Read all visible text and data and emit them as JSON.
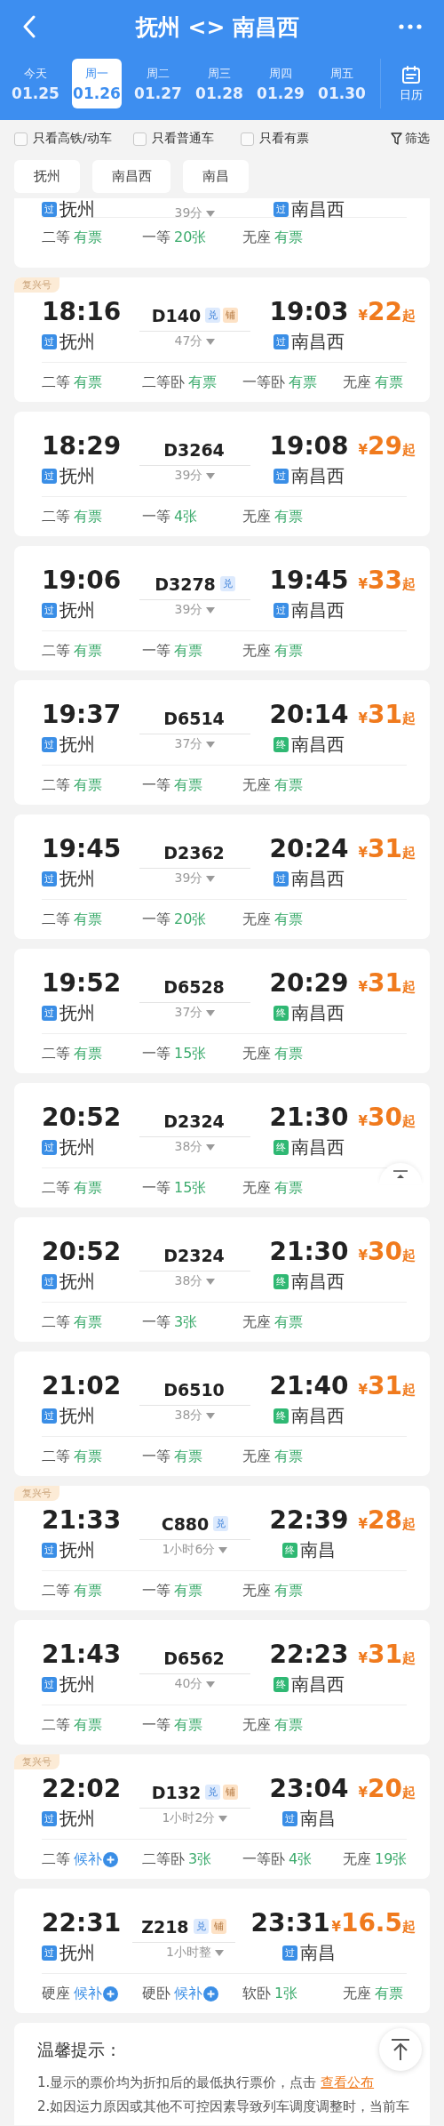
{
  "header": {
    "title": "抚州 <> 南昌西"
  },
  "dates": [
    {
      "day": "今天",
      "date": "01.25",
      "selected": false
    },
    {
      "day": "周一",
      "date": "01.26",
      "selected": true
    },
    {
      "day": "周二",
      "date": "01.27",
      "selected": false
    },
    {
      "day": "周三",
      "date": "01.28",
      "selected": false
    },
    {
      "day": "周四",
      "date": "01.29",
      "selected": false
    },
    {
      "day": "周五",
      "date": "01.30",
      "selected": false
    }
  ],
  "calendar_label": "日历",
  "filters": [
    {
      "label": "只看高铁/动车",
      "checked": false
    },
    {
      "label": "只看普通车",
      "checked": false
    },
    {
      "label": "只看有票",
      "checked": false
    }
  ],
  "filter_button": "筛选",
  "stations": [
    "抚州",
    "南昌西",
    "南昌"
  ],
  "trains": [
    {
      "kind": "partial",
      "dep": {
        "stop": {
          "label": "过",
          "kind": "pass"
        },
        "name": "抚州"
      },
      "duration": "39分",
      "arr": {
        "stop": {
          "label": "过",
          "kind": "pass"
        },
        "name": "南昌西"
      },
      "seats": [
        {
          "class": "二等",
          "status": "有票",
          "kind": "available"
        },
        {
          "class": "一等",
          "status": "20张",
          "kind": "available"
        },
        {
          "class": "无座",
          "status": "有票",
          "kind": "available"
        }
      ]
    },
    {
      "kind": "full",
      "tag": "复兴号",
      "dep_time": "18:16",
      "number": "D140",
      "badges": [
        {
          "label": "兑",
          "kind": "exchange"
        },
        {
          "label": "铺",
          "kind": "berth"
        }
      ],
      "arr_time": "19:03",
      "price": {
        "currency": "¥",
        "amount": "22",
        "suffix": "起"
      },
      "dep": {
        "stop": {
          "label": "过",
          "kind": "pass"
        },
        "name": "抚州"
      },
      "duration": "47分",
      "arr": {
        "stop": {
          "label": "过",
          "kind": "pass"
        },
        "name": "南昌西"
      },
      "seats": [
        {
          "class": "二等",
          "status": "有票",
          "kind": "available"
        },
        {
          "class": "二等卧",
          "status": "有票",
          "kind": "available"
        },
        {
          "class": "一等卧",
          "status": "有票",
          "kind": "available"
        },
        {
          "class": "无座",
          "status": "有票",
          "kind": "available"
        }
      ]
    },
    {
      "kind": "full",
      "dep_time": "18:29",
      "number": "D3264",
      "arr_time": "19:08",
      "price": {
        "currency": "¥",
        "amount": "29",
        "suffix": "起"
      },
      "dep": {
        "stop": {
          "label": "过",
          "kind": "pass"
        },
        "name": "抚州"
      },
      "duration": "39分",
      "arr": {
        "stop": {
          "label": "过",
          "kind": "pass"
        },
        "name": "南昌西"
      },
      "seats": [
        {
          "class": "二等",
          "status": "有票",
          "kind": "available"
        },
        {
          "class": "一等",
          "status": "4张",
          "kind": "available"
        },
        {
          "class": "无座",
          "status": "有票",
          "kind": "available"
        }
      ]
    },
    {
      "kind": "full",
      "dep_time": "19:06",
      "number": "D3278",
      "badges": [
        {
          "label": "兑",
          "kind": "exchange"
        }
      ],
      "arr_time": "19:45",
      "price": {
        "currency": "¥",
        "amount": "33",
        "suffix": "起"
      },
      "dep": {
        "stop": {
          "label": "过",
          "kind": "pass"
        },
        "name": "抚州"
      },
      "duration": "39分",
      "arr": {
        "stop": {
          "label": "过",
          "kind": "pass"
        },
        "name": "南昌西"
      },
      "seats": [
        {
          "class": "二等",
          "status": "有票",
          "kind": "available"
        },
        {
          "class": "一等",
          "status": "有票",
          "kind": "available"
        },
        {
          "class": "无座",
          "status": "有票",
          "kind": "available"
        }
      ]
    },
    {
      "kind": "full",
      "dep_time": "19:37",
      "number": "D6514",
      "arr_time": "20:14",
      "price": {
        "currency": "¥",
        "amount": "31",
        "suffix": "起"
      },
      "dep": {
        "stop": {
          "label": "过",
          "kind": "pass"
        },
        "name": "抚州"
      },
      "duration": "37分",
      "arr": {
        "stop": {
          "label": "终",
          "kind": "terminal"
        },
        "name": "南昌西"
      },
      "seats": [
        {
          "class": "二等",
          "status": "有票",
          "kind": "available"
        },
        {
          "class": "一等",
          "status": "有票",
          "kind": "available"
        },
        {
          "class": "无座",
          "status": "有票",
          "kind": "available"
        }
      ]
    },
    {
      "kind": "full",
      "dep_time": "19:45",
      "number": "D2362",
      "arr_time": "20:24",
      "price": {
        "currency": "¥",
        "amount": "31",
        "suffix": "起"
      },
      "dep": {
        "stop": {
          "label": "过",
          "kind": "pass"
        },
        "name": "抚州"
      },
      "duration": "39分",
      "arr": {
        "stop": {
          "label": "过",
          "kind": "pass"
        },
        "name": "南昌西"
      },
      "seats": [
        {
          "class": "二等",
          "status": "有票",
          "kind": "available"
        },
        {
          "class": "一等",
          "status": "20张",
          "kind": "available"
        },
        {
          "class": "无座",
          "status": "有票",
          "kind": "available"
        }
      ]
    },
    {
      "kind": "full",
      "dep_time": "19:52",
      "number": "D6528",
      "arr_time": "20:29",
      "price": {
        "currency": "¥",
        "amount": "31",
        "suffix": "起"
      },
      "dep": {
        "stop": {
          "label": "过",
          "kind": "pass"
        },
        "name": "抚州"
      },
      "duration": "37分",
      "arr": {
        "stop": {
          "label": "终",
          "kind": "terminal"
        },
        "name": "南昌西"
      },
      "seats": [
        {
          "class": "二等",
          "status": "有票",
          "kind": "available"
        },
        {
          "class": "一等",
          "status": "15张",
          "kind": "available"
        },
        {
          "class": "无座",
          "status": "有票",
          "kind": "available"
        }
      ]
    },
    {
      "kind": "full",
      "dep_time": "20:52",
      "number": "D2324",
      "arr_time": "21:30",
      "price": {
        "currency": "¥",
        "amount": "30",
        "suffix": "起"
      },
      "dep": {
        "stop": {
          "label": "过",
          "kind": "pass"
        },
        "name": "抚州"
      },
      "duration": "38分",
      "arr": {
        "stop": {
          "label": "终",
          "kind": "terminal"
        },
        "name": "南昌西"
      },
      "seats": [
        {
          "class": "二等",
          "status": "有票",
          "kind": "available"
        },
        {
          "class": "一等",
          "status": "15张",
          "kind": "available"
        },
        {
          "class": "无座",
          "status": "有票",
          "kind": "available"
        }
      ]
    },
    {
      "kind": "full",
      "dep_time": "20:52",
      "number": "D2324",
      "arr_time": "21:30",
      "price": {
        "currency": "¥",
        "amount": "30",
        "suffix": "起"
      },
      "dep": {
        "stop": {
          "label": "过",
          "kind": "pass"
        },
        "name": "抚州"
      },
      "duration": "38分",
      "arr": {
        "stop": {
          "label": "终",
          "kind": "terminal"
        },
        "name": "南昌西"
      },
      "seats": [
        {
          "class": "二等",
          "status": "有票",
          "kind": "available"
        },
        {
          "class": "一等",
          "status": "3张",
          "kind": "available"
        },
        {
          "class": "无座",
          "status": "有票",
          "kind": "available"
        }
      ]
    },
    {
      "kind": "full",
      "dep_time": "21:02",
      "number": "D6510",
      "arr_time": "21:40",
      "price": {
        "currency": "¥",
        "amount": "31",
        "suffix": "起"
      },
      "dep": {
        "stop": {
          "label": "过",
          "kind": "pass"
        },
        "name": "抚州"
      },
      "duration": "38分",
      "arr": {
        "stop": {
          "label": "终",
          "kind": "terminal"
        },
        "name": "南昌西"
      },
      "seats": [
        {
          "class": "二等",
          "status": "有票",
          "kind": "available"
        },
        {
          "class": "一等",
          "status": "有票",
          "kind": "available"
        },
        {
          "class": "无座",
          "status": "有票",
          "kind": "available"
        }
      ]
    },
    {
      "kind": "full",
      "tag": "复兴号",
      "dep_time": "21:33",
      "number": "C880",
      "badges": [
        {
          "label": "兑",
          "kind": "exchange"
        }
      ],
      "arr_time": "22:39",
      "price": {
        "currency": "¥",
        "amount": "28",
        "suffix": "起"
      },
      "dep": {
        "stop": {
          "label": "过",
          "kind": "pass"
        },
        "name": "抚州"
      },
      "duration": "1小时6分",
      "arr": {
        "stop": {
          "label": "终",
          "kind": "terminal"
        },
        "name": "南昌"
      },
      "seats": [
        {
          "class": "二等",
          "status": "有票",
          "kind": "available"
        },
        {
          "class": "一等",
          "status": "有票",
          "kind": "available"
        },
        {
          "class": "无座",
          "status": "有票",
          "kind": "available"
        }
      ]
    },
    {
      "kind": "full",
      "dep_time": "21:43",
      "number": "D6562",
      "arr_time": "22:23",
      "price": {
        "currency": "¥",
        "amount": "31",
        "suffix": "起"
      },
      "dep": {
        "stop": {
          "label": "过",
          "kind": "pass"
        },
        "name": "抚州"
      },
      "duration": "40分",
      "arr": {
        "stop": {
          "label": "终",
          "kind": "terminal"
        },
        "name": "南昌西"
      },
      "seats": [
        {
          "class": "二等",
          "status": "有票",
          "kind": "available"
        },
        {
          "class": "一等",
          "status": "有票",
          "kind": "available"
        },
        {
          "class": "无座",
          "status": "有票",
          "kind": "available"
        }
      ]
    },
    {
      "kind": "full",
      "tag": "复兴号",
      "dep_time": "22:02",
      "number": "D132",
      "badges": [
        {
          "label": "兑",
          "kind": "exchange"
        },
        {
          "label": "铺",
          "kind": "berth"
        }
      ],
      "arr_time": "23:04",
      "price": {
        "currency": "¥",
        "amount": "20",
        "suffix": "起"
      },
      "dep": {
        "stop": {
          "label": "过",
          "kind": "pass"
        },
        "name": "抚州"
      },
      "duration": "1小时2分",
      "arr": {
        "stop": {
          "label": "过",
          "kind": "pass"
        },
        "name": "南昌"
      },
      "seats": [
        {
          "class": "二等",
          "status": "候补",
          "kind": "waitlist"
        },
        {
          "class": "二等卧",
          "status": "3张",
          "kind": "available"
        },
        {
          "class": "一等卧",
          "status": "4张",
          "kind": "available"
        },
        {
          "class": "无座",
          "status": "19张",
          "kind": "available"
        }
      ]
    },
    {
      "kind": "full",
      "dep_time": "22:31",
      "number": "Z218",
      "badges": [
        {
          "label": "兑",
          "kind": "exchange"
        },
        {
          "label": "铺",
          "kind": "berth"
        }
      ],
      "arr_time": "23:31",
      "price": {
        "currency": "¥",
        "amount": "16.5",
        "suffix": "起"
      },
      "dep": {
        "stop": {
          "label": "过",
          "kind": "pass"
        },
        "name": "抚州"
      },
      "duration": "1小时整",
      "arr": {
        "stop": {
          "label": "过",
          "kind": "pass"
        },
        "name": "南昌"
      },
      "seats": [
        {
          "class": "硬座",
          "status": "候补",
          "kind": "waitlist"
        },
        {
          "class": "硬卧",
          "status": "候补",
          "kind": "waitlist"
        },
        {
          "class": "软卧",
          "status": "1张",
          "kind": "available"
        },
        {
          "class": "无座",
          "status": "有票",
          "kind": "available"
        }
      ]
    }
  ],
  "tips": {
    "title": "温馨提示：",
    "lines": [
      {
        "text": "1.显示的票价均为折扣后的最低执行票价，点击 ",
        "link": "查看公布"
      },
      {
        "text": "2.如因运力原因或其他不可控因素导致列车调度调整时，当前车"
      }
    ]
  }
}
